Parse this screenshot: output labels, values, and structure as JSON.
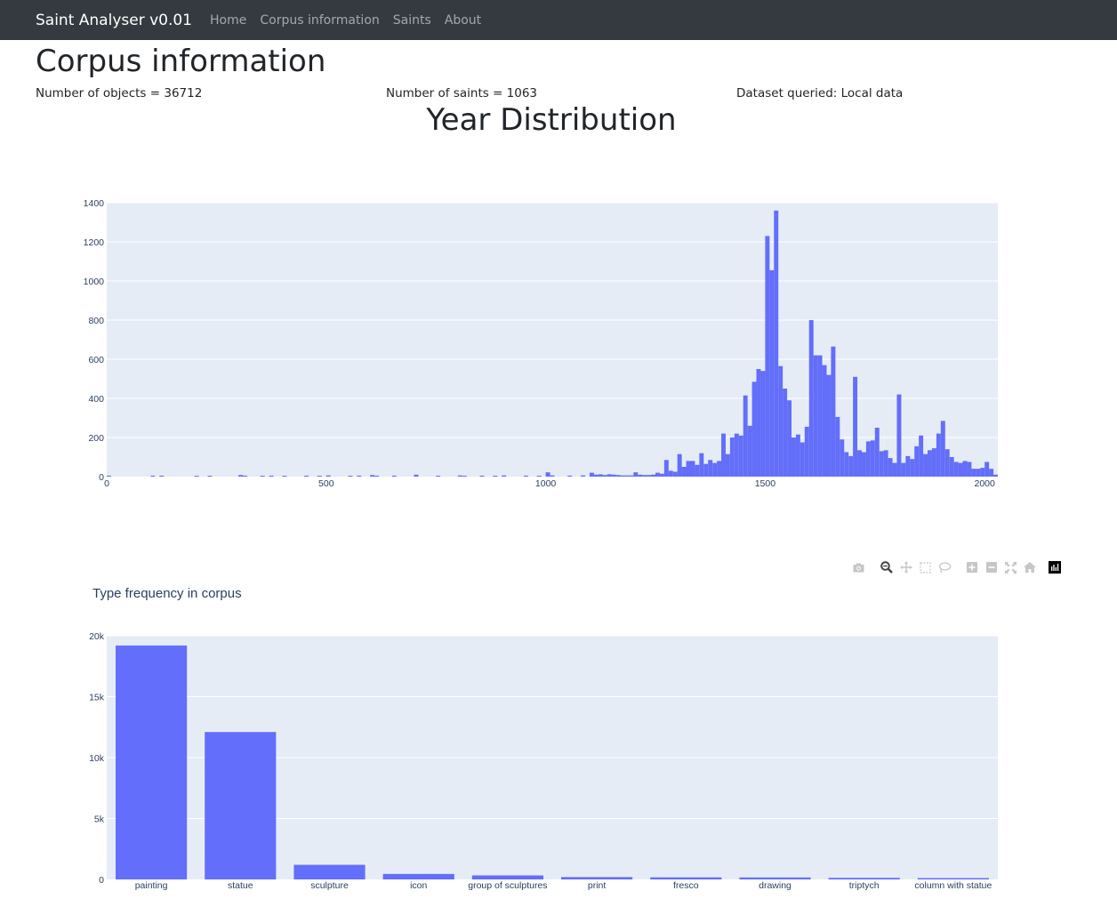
{
  "nav": {
    "brand": "Saint Analyser v0.01",
    "links": [
      "Home",
      "Corpus information",
      "Saints",
      "About"
    ]
  },
  "page": {
    "title": "Corpus information",
    "stats": {
      "objects": "Number of objects = 36712",
      "saints": "Number of saints = 1063",
      "dataset": "Dataset queried: Local data"
    },
    "section_title": "Year Distribution"
  },
  "colors": {
    "bar": "#636efa",
    "plot_bg": "#e5ecf6",
    "navbar": "#343a40"
  },
  "modebar": {
    "icons": [
      "camera-icon",
      "zoom-icon",
      "pan-icon",
      "box-select-icon",
      "lasso-icon",
      "zoom-in-icon",
      "zoom-out-icon",
      "autoscale-icon",
      "reset-axes-icon",
      "plotly-logo-icon"
    ]
  },
  "chart_data": [
    {
      "type": "bar",
      "subtype": "histogram",
      "title": "",
      "xlabel": "",
      "ylabel": "",
      "xlim": [
        0,
        2030
      ],
      "ylim": [
        0,
        1400
      ],
      "bin_width": 10,
      "xticks": [
        0,
        500,
        1000,
        1500,
        2000
      ],
      "yticks": [
        0,
        200,
        400,
        600,
        800,
        1000,
        1200,
        1400
      ],
      "bins": [
        [
          0,
          5
        ],
        [
          100,
          5
        ],
        [
          120,
          5
        ],
        [
          200,
          4
        ],
        [
          230,
          4
        ],
        [
          300,
          8
        ],
        [
          310,
          5
        ],
        [
          350,
          4
        ],
        [
          370,
          5
        ],
        [
          400,
          4
        ],
        [
          450,
          5
        ],
        [
          480,
          4
        ],
        [
          500,
          6
        ],
        [
          550,
          4
        ],
        [
          570,
          5
        ],
        [
          600,
          8
        ],
        [
          610,
          4
        ],
        [
          650,
          5
        ],
        [
          700,
          10
        ],
        [
          750,
          4
        ],
        [
          800,
          6
        ],
        [
          810,
          4
        ],
        [
          850,
          5
        ],
        [
          880,
          4
        ],
        [
          900,
          6
        ],
        [
          950,
          5
        ],
        [
          980,
          4
        ],
        [
          1000,
          22
        ],
        [
          1010,
          6
        ],
        [
          1050,
          5
        ],
        [
          1080,
          6
        ],
        [
          1100,
          20
        ],
        [
          1110,
          10
        ],
        [
          1120,
          12
        ],
        [
          1130,
          8
        ],
        [
          1140,
          12
        ],
        [
          1150,
          10
        ],
        [
          1160,
          8
        ],
        [
          1170,
          6
        ],
        [
          1180,
          6
        ],
        [
          1190,
          6
        ],
        [
          1200,
          22
        ],
        [
          1210,
          10
        ],
        [
          1220,
          8
        ],
        [
          1230,
          8
        ],
        [
          1240,
          10
        ],
        [
          1250,
          20
        ],
        [
          1260,
          15
        ],
        [
          1270,
          85
        ],
        [
          1280,
          30
        ],
        [
          1290,
          25
        ],
        [
          1300,
          115
        ],
        [
          1310,
          50
        ],
        [
          1320,
          80
        ],
        [
          1330,
          80
        ],
        [
          1340,
          60
        ],
        [
          1350,
          120
        ],
        [
          1360,
          65
        ],
        [
          1370,
          85
        ],
        [
          1380,
          70
        ],
        [
          1390,
          80
        ],
        [
          1400,
          220
        ],
        [
          1410,
          115
        ],
        [
          1420,
          200
        ],
        [
          1430,
          220
        ],
        [
          1440,
          210
        ],
        [
          1450,
          415
        ],
        [
          1460,
          260
        ],
        [
          1470,
          485
        ],
        [
          1480,
          550
        ],
        [
          1490,
          540
        ],
        [
          1500,
          1230
        ],
        [
          1510,
          1055
        ],
        [
          1520,
          1360
        ],
        [
          1530,
          565
        ],
        [
          1540,
          450
        ],
        [
          1550,
          390
        ],
        [
          1560,
          200
        ],
        [
          1570,
          215
        ],
        [
          1580,
          175
        ],
        [
          1590,
          255
        ],
        [
          1600,
          800
        ],
        [
          1610,
          620
        ],
        [
          1620,
          620
        ],
        [
          1630,
          570
        ],
        [
          1640,
          520
        ],
        [
          1650,
          665
        ],
        [
          1660,
          305
        ],
        [
          1670,
          190
        ],
        [
          1680,
          125
        ],
        [
          1690,
          105
        ],
        [
          1700,
          510
        ],
        [
          1710,
          135
        ],
        [
          1720,
          125
        ],
        [
          1730,
          180
        ],
        [
          1740,
          185
        ],
        [
          1750,
          250
        ],
        [
          1760,
          130
        ],
        [
          1770,
          135
        ],
        [
          1780,
          95
        ],
        [
          1790,
          70
        ],
        [
          1800,
          420
        ],
        [
          1810,
          70
        ],
        [
          1820,
          105
        ],
        [
          1830,
          90
        ],
        [
          1840,
          155
        ],
        [
          1850,
          210
        ],
        [
          1860,
          115
        ],
        [
          1870,
          135
        ],
        [
          1880,
          145
        ],
        [
          1890,
          220
        ],
        [
          1900,
          285
        ],
        [
          1910,
          140
        ],
        [
          1920,
          100
        ],
        [
          1930,
          75
        ],
        [
          1940,
          70
        ],
        [
          1950,
          80
        ],
        [
          1960,
          75
        ],
        [
          1970,
          40
        ],
        [
          1980,
          40
        ],
        [
          1990,
          45
        ],
        [
          2000,
          75
        ],
        [
          2010,
          40
        ],
        [
          2020,
          10
        ]
      ]
    },
    {
      "type": "bar",
      "title": "Type frequency in corpus",
      "xlabel": "",
      "ylabel": "",
      "ylim": [
        0,
        20000
      ],
      "yticks": [
        0,
        5000,
        10000,
        15000,
        20000
      ],
      "ytick_labels": [
        "0",
        "5k",
        "10k",
        "15k",
        "20k"
      ],
      "categories": [
        "painting",
        "statue",
        "sculpture",
        "icon",
        "group of sculptures",
        "print",
        "fresco",
        "drawing",
        "triptych",
        "column with statue"
      ],
      "values": [
        19200,
        12100,
        1200,
        450,
        330,
        190,
        170,
        160,
        130,
        110
      ]
    }
  ]
}
